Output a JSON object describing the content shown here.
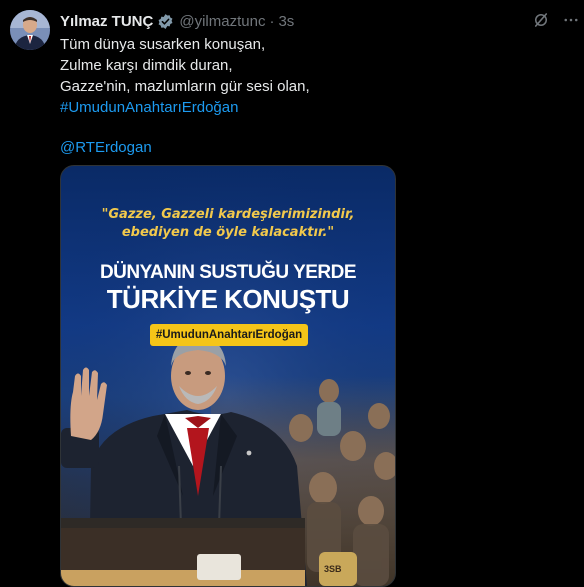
{
  "tweet": {
    "display_name": "Yılmaz TUNÇ",
    "handle": "@yilmaztunc",
    "separator": "·",
    "time": "3s",
    "lines": [
      "Tüm dünya susarken konuşan,",
      "Zulme karşı dimdik duran,",
      "Gazze'nin, mazlumların gür sesi olan,"
    ],
    "hashtag": "#UmudunAnahtarıErdoğan",
    "mention": "@RTErdogan"
  },
  "media": {
    "quote_line1": "\"Gazze, Gazzeli kardeşlerimizindir,",
    "quote_line2": "ebediyen de öyle kalacaktır.\"",
    "headline1": "DÜNYANIN SUSTUĞU YERDE",
    "headline2": "TÜRKİYE KONUŞTU",
    "pill_text": "#UmudunAnahtarıErdoğan",
    "shirt_text": "3SB"
  },
  "icons": [
    "verified-badge-icon",
    "grok-icon",
    "more-icon"
  ],
  "colors": {
    "background": "#000000",
    "text": "#e7e9ea",
    "muted": "#71767b",
    "link": "#1d9bf0",
    "accent_yellow": "#f5c518"
  }
}
